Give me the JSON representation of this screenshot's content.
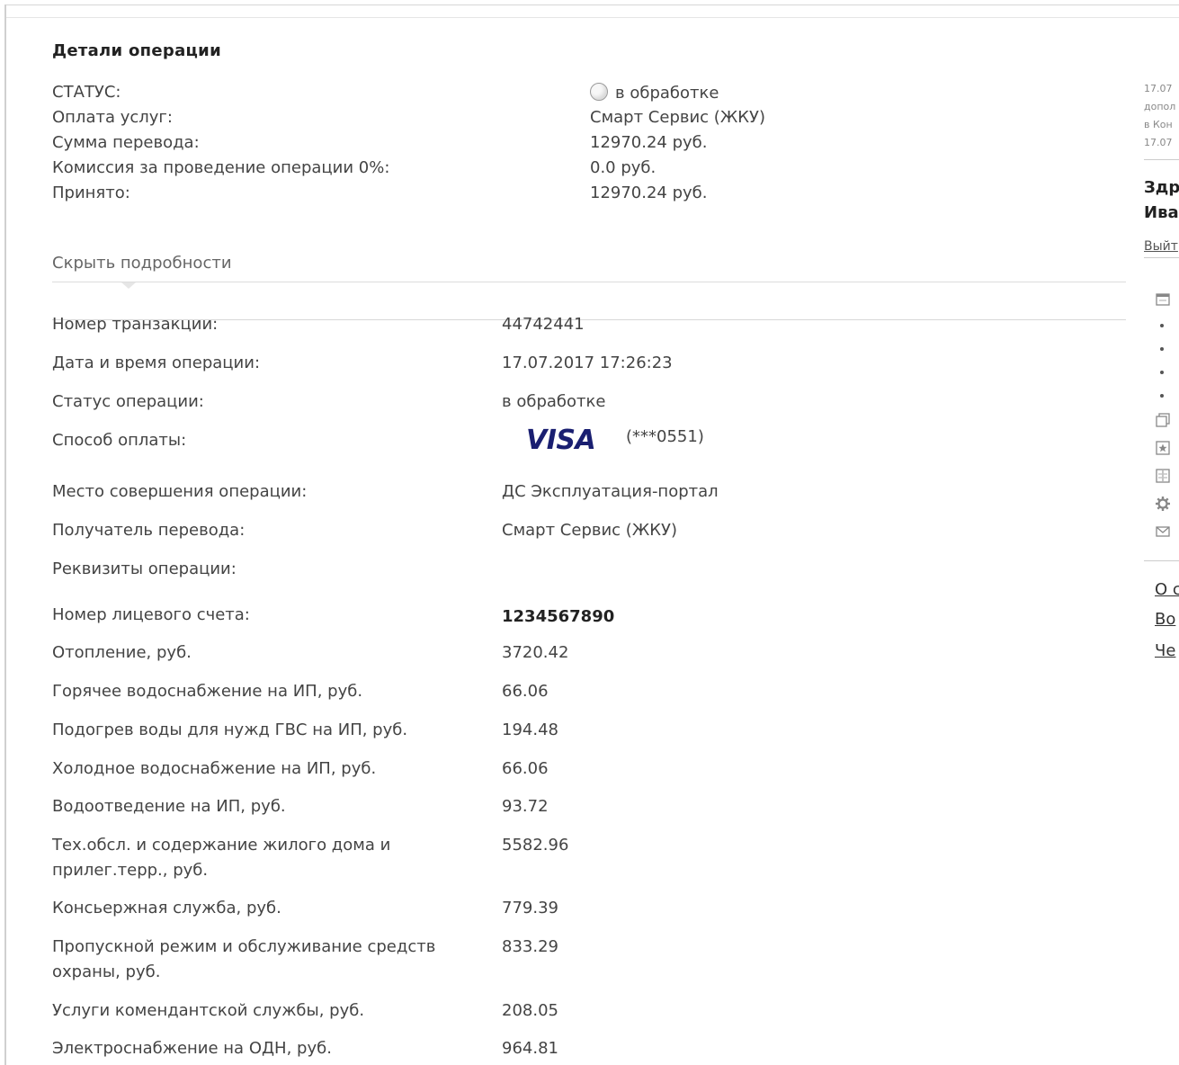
{
  "panel": {
    "title": "Детали операции",
    "summary": [
      {
        "label": "СТАТУС:",
        "value": "в обработке"
      },
      {
        "label": "Оплата услуг:",
        "value": "Смарт Сервис (ЖКУ)"
      },
      {
        "label": "Сумма перевода:",
        "value": "12970.24 руб."
      },
      {
        "label": "Комиссия за проведение операции 0%:",
        "value": "0.0 руб."
      },
      {
        "label": "Принято:",
        "value": "12970.24 руб."
      }
    ],
    "hide_details_label": "Скрыть подробности"
  },
  "details": {
    "transaction_number": {
      "label": "Номер транзакции:",
      "value": "44742441"
    },
    "datetime": {
      "label": "Дата и время операции:",
      "value": "17.07.2017 17:26:23"
    },
    "status": {
      "label": "Статус операции:",
      "value": "в обработке"
    },
    "payment_method": {
      "label": "Способ оплаты:",
      "card_brand": "VISA",
      "card_mask": "(***0551)"
    },
    "place": {
      "label": "Место совершения операции:",
      "value": "ДС Эксплуатация-портал"
    },
    "recipient": {
      "label": "Получатель перевода:",
      "value": "Смарт Сервис (ЖКУ)"
    },
    "requisites": {
      "label": "Реквизиты операции:"
    },
    "account": {
      "label": "Номер лицевого счета:",
      "value": "1234567890"
    },
    "items": [
      {
        "label": "Отопление, руб.",
        "value": "3720.42"
      },
      {
        "label": "Горячее водоснабжение на ИП, руб.",
        "value": "66.06"
      },
      {
        "label": "Подогрев воды для нужд ГВС на ИП, руб.",
        "value": "194.48"
      },
      {
        "label": "Холодное водоснабжение на ИП, руб.",
        "value": "66.06"
      },
      {
        "label": "Водоотведение на ИП, руб.",
        "value": "93.72"
      },
      {
        "label1": "Тех.обсл. и содержание жилого дома и",
        "label2": "прилег.терр., руб.",
        "value": "5582.96"
      },
      {
        "label": "Консьержная служба, руб.",
        "value": "779.39"
      },
      {
        "label1": "Пропускной режим и обслуживание средств",
        "label2": "охраны, руб.",
        "value": "833.29"
      },
      {
        "label": "Услуги комендантской службы, руб.",
        "value": "208.05"
      },
      {
        "label": "Электроснабжение на ОДН, руб.",
        "value": "964.81"
      }
    ]
  },
  "sidebar": {
    "notice_lines": [
      "17.07",
      "допол",
      "в Кон",
      "17.07"
    ],
    "greeting_line1": "Здр",
    "greeting_line2": "Ива",
    "logout_label": "Выйт",
    "links": [
      "О с",
      "Во",
      "Че"
    ]
  },
  "colors": {
    "visa_blue": "#1a1f71",
    "text": "#444444",
    "divider": "#dddddd"
  }
}
